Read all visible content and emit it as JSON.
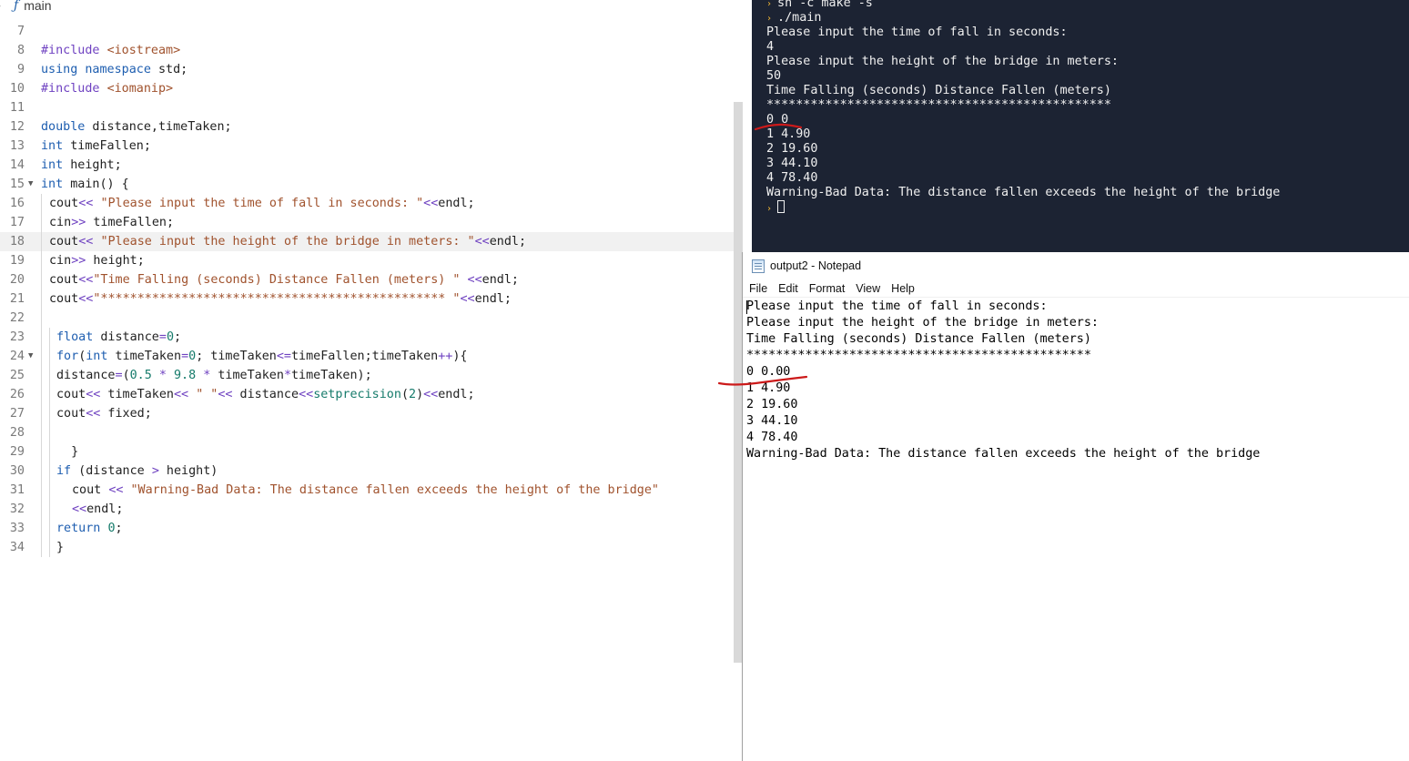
{
  "editor": {
    "breadcrumb": "main",
    "lines": [
      {
        "n": "7",
        "html": ""
      },
      {
        "n": "8",
        "html": "<span class='o'>#include</span> <span class='s'>&lt;iostream&gt;</span>"
      },
      {
        "n": "9",
        "html": "<span class='k'>using</span> <span class='k'>namespace</span> std;"
      },
      {
        "n": "10",
        "html": "<span class='o'>#include</span> <span class='s'>&lt;iomanip&gt;</span>"
      },
      {
        "n": "11",
        "html": ""
      },
      {
        "n": "12",
        "html": "<span class='k'>double</span> distance,timeTaken;"
      },
      {
        "n": "13",
        "html": "<span class='k'>int</span> timeFallen;"
      },
      {
        "n": "14",
        "html": "<span class='k'>int</span> height;"
      },
      {
        "n": "15",
        "fold": true,
        "html": "<span class='k'>int</span> main() {"
      },
      {
        "n": "16",
        "indent": 1,
        "html": "cout<span class='o'>&lt;&lt;</span> <span class='s'>\"Please input the time of fall in seconds: \"</span><span class='o'>&lt;&lt;</span>endl;"
      },
      {
        "n": "17",
        "indent": 1,
        "html": "cin<span class='o'>&gt;&gt;</span> timeFallen;"
      },
      {
        "n": "18",
        "indent": 1,
        "active": true,
        "html": "cout<span class='o'>&lt;&lt;</span> <span class='s'>\"Please input the height of the bridge in meters: \"</span><span class='o'>&lt;&lt;</span>endl;"
      },
      {
        "n": "19",
        "indent": 1,
        "html": "cin<span class='o'>&gt;&gt;</span> height;"
      },
      {
        "n": "20",
        "indent": 1,
        "html": "cout<span class='o'>&lt;&lt;</span><span class='s'>\"Time Falling (seconds) Distance Fallen (meters) \"</span> <span class='o'>&lt;&lt;</span>endl;"
      },
      {
        "n": "21",
        "indent": 1,
        "html": "cout<span class='o'>&lt;&lt;</span><span class='s'>\"*********************************************** \"</span><span class='o'>&lt;&lt;</span>endl;"
      },
      {
        "n": "22",
        "indent": 1,
        "html": ""
      },
      {
        "n": "23",
        "indent": 2,
        "html": "<span class='k'>float</span> distance<span class='o'>=</span><span class='n'>0</span>;"
      },
      {
        "n": "24",
        "indent": 2,
        "fold": true,
        "html": "<span class='k'>for</span>(<span class='k'>int</span> timeTaken<span class='o'>=</span><span class='n'>0</span>; timeTaken<span class='o'>&lt;=</span>timeFallen;timeTaken<span class='o'>++</span>){"
      },
      {
        "n": "25",
        "indent": 2,
        "html": "distance<span class='o'>=</span>(<span class='n'>0.5</span> <span class='o'>*</span> <span class='n'>9.8</span> <span class='o'>*</span> timeTaken<span class='o'>*</span>timeTaken);"
      },
      {
        "n": "26",
        "indent": 2,
        "html": "cout<span class='o'>&lt;&lt;</span> timeTaken<span class='o'>&lt;&lt;</span> <span class='s'>\" \"</span><span class='o'>&lt;&lt;</span> distance<span class='o'>&lt;&lt;</span><span class='n'>setprecision</span>(<span class='n'>2</span>)<span class='o'>&lt;&lt;</span>endl;"
      },
      {
        "n": "27",
        "indent": 2,
        "html": "cout<span class='o'>&lt;&lt;</span> fixed;"
      },
      {
        "n": "28",
        "indent": 2,
        "html": ""
      },
      {
        "n": "29",
        "indent": 2,
        "html": "  }"
      },
      {
        "n": "30",
        "indent": 2,
        "html": "<span class='k'>if</span> (distance <span class='o'>&gt;</span> height)"
      },
      {
        "n": "31",
        "indent": 3,
        "html": "cout <span class='o'>&lt;&lt;</span> <span class='s'>\"Warning-Bad Data: The distance fallen exceeds the height of the bridge\"</span>"
      },
      {
        "n": "32",
        "indent": 3,
        "html": "<span class='o'>&lt;&lt;</span>endl;"
      },
      {
        "n": "33",
        "indent": 2,
        "html": "<span class='k'>return</span> <span class='n'>0</span>;"
      },
      {
        "n": "34",
        "indent": 2,
        "html": "}"
      }
    ]
  },
  "terminal": {
    "lines": [
      {
        "prompt": true,
        "text": "sh -c make -s"
      },
      {
        "prompt": true,
        "text": "./main"
      },
      {
        "text": "Please input the time of fall in seconds:"
      },
      {
        "text": "4"
      },
      {
        "text": "Please input the height of the bridge in meters:"
      },
      {
        "text": "50"
      },
      {
        "text": "Time Falling (seconds) Distance Fallen (meters)"
      },
      {
        "text": "***********************************************"
      },
      {
        "text": "0 0"
      },
      {
        "text": "1 4.90"
      },
      {
        "text": "2 19.60"
      },
      {
        "text": "3 44.10"
      },
      {
        "text": "4 78.40"
      },
      {
        "text": "Warning-Bad Data: The distance fallen exceeds the height of the bridge"
      },
      {
        "prompt": true,
        "cursor": true,
        "text": ""
      }
    ],
    "prompt_glyph": "›"
  },
  "notepad": {
    "title": "output2 - Notepad",
    "menu": [
      "File",
      "Edit",
      "Format",
      "View",
      "Help"
    ],
    "lines": [
      "Please input the time of fall in seconds:",
      "Please input the height of the bridge in meters:",
      "Time Falling (seconds) Distance Fallen (meters)",
      "***********************************************",
      "0 0.00",
      "1 4.90",
      "2 19.60",
      "3 44.10",
      "4 78.40",
      "Warning-Bad Data: The distance fallen exceeds the height of the bridge"
    ]
  },
  "colors": {
    "annotation": "#cc1a1a",
    "terminal_bg": "#1c2333",
    "keyword": "#1e5eb0",
    "string": "#a0522d"
  }
}
